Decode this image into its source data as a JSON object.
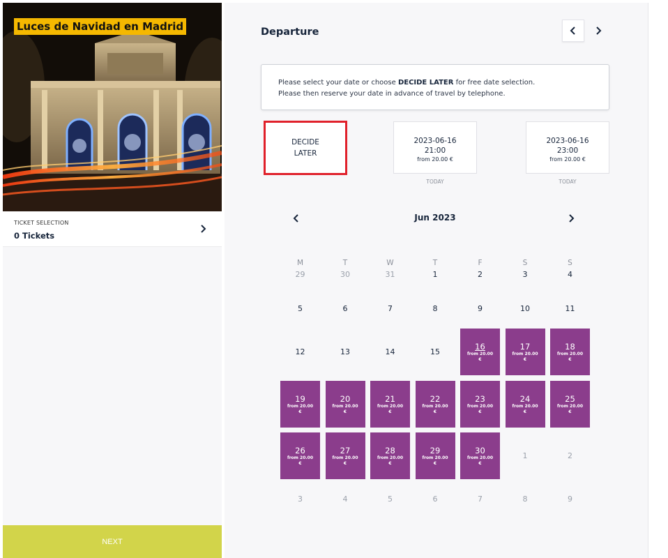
{
  "event": {
    "title": "Luces de Navidad en Madrid"
  },
  "ticket_selection": {
    "label": "TICKET SELECTION",
    "count": "0 Tickets"
  },
  "next_button": "NEXT",
  "departure": {
    "title": "Departure",
    "info_line1_pre": "Please select your date or choose ",
    "info_line1_bold": "DECIDE LATER",
    "info_line1_post": " for free date selection.",
    "info_line2": "Please then reserve your date in advance of travel by telephone."
  },
  "date_cards": {
    "decide_line1": "DECIDE",
    "decide_line2": "LATER",
    "cards": [
      {
        "date": "2023-06-16",
        "time": "21:00",
        "price": "from 20.00 €",
        "sub": "TODAY"
      },
      {
        "date": "2023-06-16",
        "time": "23:00",
        "price": "from 20.00 €",
        "sub": "TODAY"
      }
    ]
  },
  "calendar": {
    "month": "Jun 2023",
    "weekdays": [
      "M",
      "T",
      "W",
      "T",
      "F",
      "S",
      "S"
    ],
    "weeks": [
      [
        {
          "d": "29",
          "s": "muted"
        },
        {
          "d": "30",
          "s": "muted"
        },
        {
          "d": "31",
          "s": "muted"
        },
        {
          "d": "1",
          "s": "normal"
        },
        {
          "d": "2",
          "s": "normal"
        },
        {
          "d": "3",
          "s": "normal"
        },
        {
          "d": "4",
          "s": "normal"
        }
      ],
      [
        {
          "d": "5",
          "s": "normal"
        },
        {
          "d": "6",
          "s": "normal"
        },
        {
          "d": "7",
          "s": "normal"
        },
        {
          "d": "8",
          "s": "normal"
        },
        {
          "d": "9",
          "s": "normal"
        },
        {
          "d": "10",
          "s": "normal"
        },
        {
          "d": "11",
          "s": "normal"
        }
      ],
      [
        {
          "d": "12",
          "s": "normal"
        },
        {
          "d": "13",
          "s": "normal"
        },
        {
          "d": "14",
          "s": "normal"
        },
        {
          "d": "15",
          "s": "normal"
        },
        {
          "d": "16",
          "s": "today"
        },
        {
          "d": "17",
          "s": "avail"
        },
        {
          "d": "18",
          "s": "avail"
        }
      ],
      [
        {
          "d": "19",
          "s": "avail"
        },
        {
          "d": "20",
          "s": "avail"
        },
        {
          "d": "21",
          "s": "avail"
        },
        {
          "d": "22",
          "s": "avail"
        },
        {
          "d": "23",
          "s": "avail"
        },
        {
          "d": "24",
          "s": "avail"
        },
        {
          "d": "25",
          "s": "avail"
        }
      ],
      [
        {
          "d": "26",
          "s": "avail"
        },
        {
          "d": "27",
          "s": "avail"
        },
        {
          "d": "28",
          "s": "avail"
        },
        {
          "d": "29",
          "s": "avail"
        },
        {
          "d": "30",
          "s": "avail"
        },
        {
          "d": "1",
          "s": "muted"
        },
        {
          "d": "2",
          "s": "muted"
        }
      ],
      [
        {
          "d": "3",
          "s": "muted"
        },
        {
          "d": "4",
          "s": "muted"
        },
        {
          "d": "5",
          "s": "muted"
        },
        {
          "d": "6",
          "s": "muted"
        },
        {
          "d": "7",
          "s": "muted"
        },
        {
          "d": "8",
          "s": "muted"
        },
        {
          "d": "9",
          "s": "muted"
        }
      ]
    ],
    "avail_price": "from 20.00 €"
  },
  "colors": {
    "available_day": "#8b3d8c",
    "next_button": "#d2d44a",
    "title_badge": "#f5b800",
    "highlight_border": "#e0202a"
  },
  "icons": {
    "ticket_chevron": "chevron-right-icon",
    "prev_week": "chevron-left-icon",
    "next_week": "chevron-right-icon",
    "prev_month": "chevron-left-icon",
    "next_month": "chevron-right-icon"
  }
}
